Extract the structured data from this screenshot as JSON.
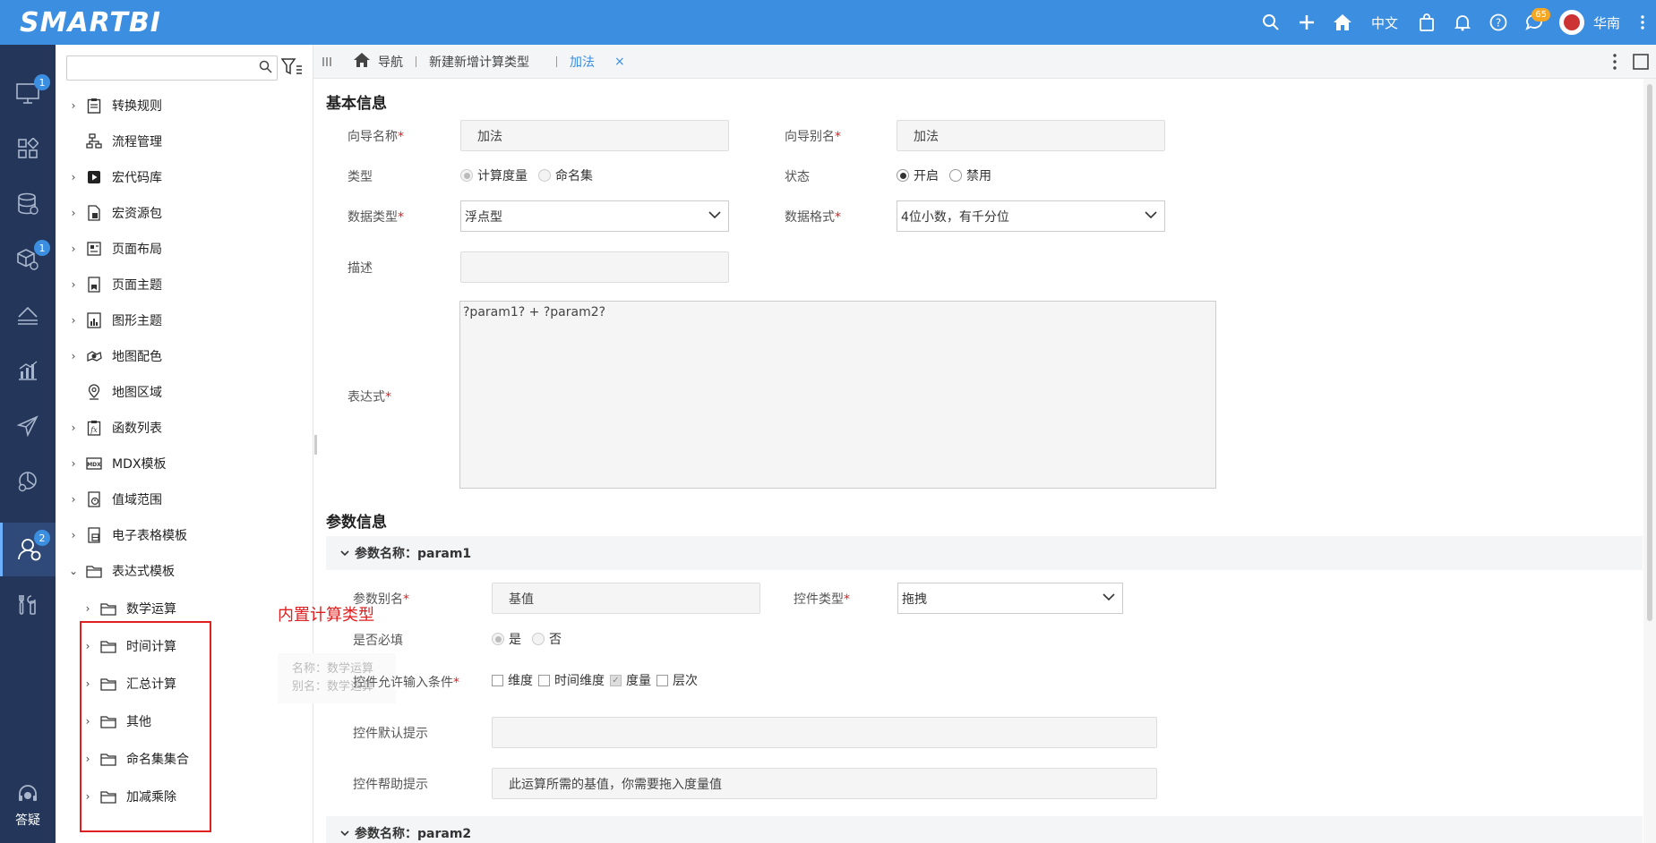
{
  "app": {
    "logo": "SMARTBI"
  },
  "topbar": {
    "lang": "中文",
    "message_count": "65",
    "user": "华南"
  },
  "rail": {
    "badge_1": "1",
    "badge_2": "1",
    "badge_3": "2",
    "help_label": "答疑"
  },
  "tree": {
    "search_placeholder": "",
    "items": [
      {
        "label": "转换规则"
      },
      {
        "label": "流程管理"
      },
      {
        "label": "宏代码库"
      },
      {
        "label": "宏资源包"
      },
      {
        "label": "页面布局"
      },
      {
        "label": "页面主题"
      },
      {
        "label": "图形主题"
      },
      {
        "label": "地图配色"
      },
      {
        "label": "地图区域"
      },
      {
        "label": "函数列表"
      },
      {
        "label": "MDX模板"
      },
      {
        "label": "值域范围"
      },
      {
        "label": "电子表格模板"
      },
      {
        "label": "表达式模板"
      }
    ],
    "children": [
      {
        "label": "数学运算"
      },
      {
        "label": "时间计算"
      },
      {
        "label": "汇总计算"
      },
      {
        "label": "其他"
      },
      {
        "label": "命名集集合"
      },
      {
        "label": "加减乘除"
      }
    ],
    "annotation": "内置计算类型",
    "tooltip_name": "名称：数学运算",
    "tooltip_alias": "别名：数学运算"
  },
  "tabs": {
    "nav": "导航",
    "new_calc": "新建新增计算类型",
    "active": "加法",
    "close": "×"
  },
  "basic": {
    "title": "基本信息",
    "wizard_name_label": "向导名称",
    "wizard_name": "加法",
    "wizard_alias_label": "向导别名",
    "wizard_alias": "加法",
    "type_label": "类型",
    "type_opt1": "计算度量",
    "type_opt2": "命名集",
    "status_label": "状态",
    "status_opt1": "开启",
    "status_opt2": "禁用",
    "datatype_label": "数据类型",
    "datatype": "浮点型",
    "dataformat_label": "数据格式",
    "dataformat": "4位小数，有千分位",
    "desc_label": "描述",
    "desc": "",
    "expr_label": "表达式",
    "expr": "?param1? + ?param2?"
  },
  "params": {
    "title": "参数信息",
    "p1_head": "参数名称：param1",
    "alias_label": "参数别名",
    "alias": "基值",
    "ctrl_type_label": "控件类型",
    "ctrl_type": "拖拽",
    "required_label": "是否必填",
    "yes": "是",
    "no": "否",
    "allow_label": "控件允许输入条件",
    "cond1": "维度",
    "cond2": "时间维度",
    "cond3": "度量",
    "cond4": "层次",
    "default_hint_label": "控件默认提示",
    "default_hint": "",
    "help_hint_label": "控件帮助提示",
    "help_hint": "此运算所需的基值，你需要拖入度量值",
    "p2_head": "参数名称：param2"
  }
}
